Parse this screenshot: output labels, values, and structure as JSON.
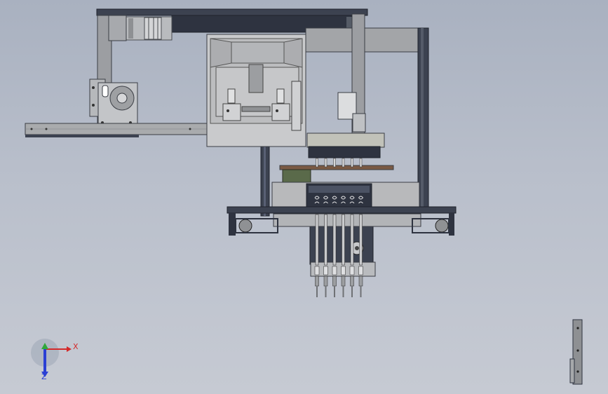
{
  "viewport": {
    "background_top": "#a9b1c0",
    "background_bottom": "#c6cad3"
  },
  "model": {
    "frame_color": "#3c4250",
    "plate_color": "#a8a9ab",
    "dark_color": "#2e3340",
    "nozzle_count": 6
  },
  "triad": {
    "x_label": "X",
    "z_label": "Z",
    "x_color": "#d42a2a",
    "y_color": "#2fa83a",
    "z_color": "#2a3fd4"
  }
}
